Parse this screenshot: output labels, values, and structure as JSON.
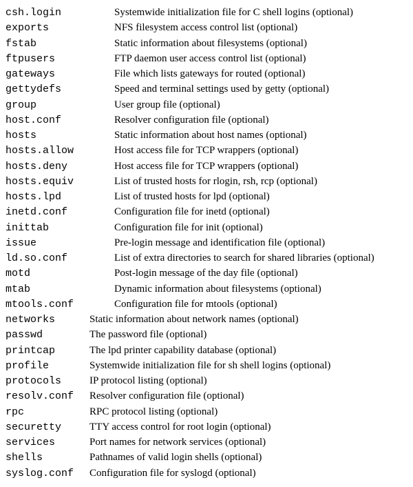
{
  "entries": [
    {
      "name": "csh.login",
      "desc": "Systemwide initialization file for C shell logins (optional)",
      "col": "a"
    },
    {
      "name": "exports",
      "desc": "NFS filesystem access control list (optional)",
      "col": "a"
    },
    {
      "name": "fstab",
      "desc": "Static information about filesystems (optional)",
      "col": "a"
    },
    {
      "name": "ftpusers",
      "desc": "FTP daemon user access control list (optional)",
      "col": "a"
    },
    {
      "name": "gateways",
      "desc": "File which lists gateways for routed (optional)",
      "col": "a"
    },
    {
      "name": "gettydefs",
      "desc": "Speed and terminal settings used by getty (optional)",
      "col": "a"
    },
    {
      "name": "group",
      "desc": "User group file (optional)",
      "col": "a"
    },
    {
      "name": "host.conf",
      "desc": "Resolver configuration file (optional)",
      "col": "a"
    },
    {
      "name": "hosts",
      "desc": "Static information about host names (optional)",
      "col": "a"
    },
    {
      "name": "hosts.allow",
      "desc": "Host access file for TCP wrappers (optional)",
      "col": "a"
    },
    {
      "name": "hosts.deny",
      "desc": "Host access file for TCP wrappers (optional)",
      "col": "a"
    },
    {
      "name": "hosts.equiv",
      "desc": "List of trusted hosts for rlogin, rsh, rcp (optional)",
      "col": "a"
    },
    {
      "name": "hosts.lpd",
      "desc": "List of trusted hosts for lpd (optional)",
      "col": "a"
    },
    {
      "name": "inetd.conf",
      "desc": "Configuration file for inetd (optional)",
      "col": "a"
    },
    {
      "name": "inittab",
      "desc": "Configuration file for init (optional)",
      "col": "a"
    },
    {
      "name": "issue",
      "desc": "Pre-login message and identification file (optional)",
      "col": "a"
    },
    {
      "name": "ld.so.conf",
      "desc": "List of extra directories to search for shared libraries (optional)",
      "col": "a"
    },
    {
      "name": "motd",
      "desc": "Post-login message of the day file (optional)",
      "col": "a"
    },
    {
      "name": "mtab",
      "desc": "Dynamic information about filesystems (optional)",
      "col": "a"
    },
    {
      "name": "mtools.conf",
      "desc": "Configuration file for mtools (optional)",
      "col": "a"
    },
    {
      "name": "networks",
      "desc": "Static information about network names (optional)",
      "col": "b"
    },
    {
      "name": "passwd",
      "desc": "The password file (optional)",
      "col": "b"
    },
    {
      "name": "printcap",
      "desc": "The lpd printer capability database (optional)",
      "col": "b"
    },
    {
      "name": "profile",
      "desc": "Systemwide initialization file for sh shell logins (optional)",
      "col": "b"
    },
    {
      "name": "protocols",
      "desc": "IP protocol listing (optional)",
      "col": "b"
    },
    {
      "name": "resolv.conf",
      "desc": "Resolver configuration file (optional)",
      "col": "b"
    },
    {
      "name": "rpc",
      "desc": "RPC protocol listing (optional)",
      "col": "b"
    },
    {
      "name": "securetty",
      "desc": "TTY access control for root login (optional)",
      "col": "b"
    },
    {
      "name": "services",
      "desc": "Port names for network services (optional)",
      "col": "b"
    },
    {
      "name": "shells",
      "desc": "Pathnames of valid login shells (optional)",
      "col": "b"
    },
    {
      "name": "syslog.conf",
      "desc": "Configuration file for syslogd (optional)",
      "col": "b"
    }
  ]
}
